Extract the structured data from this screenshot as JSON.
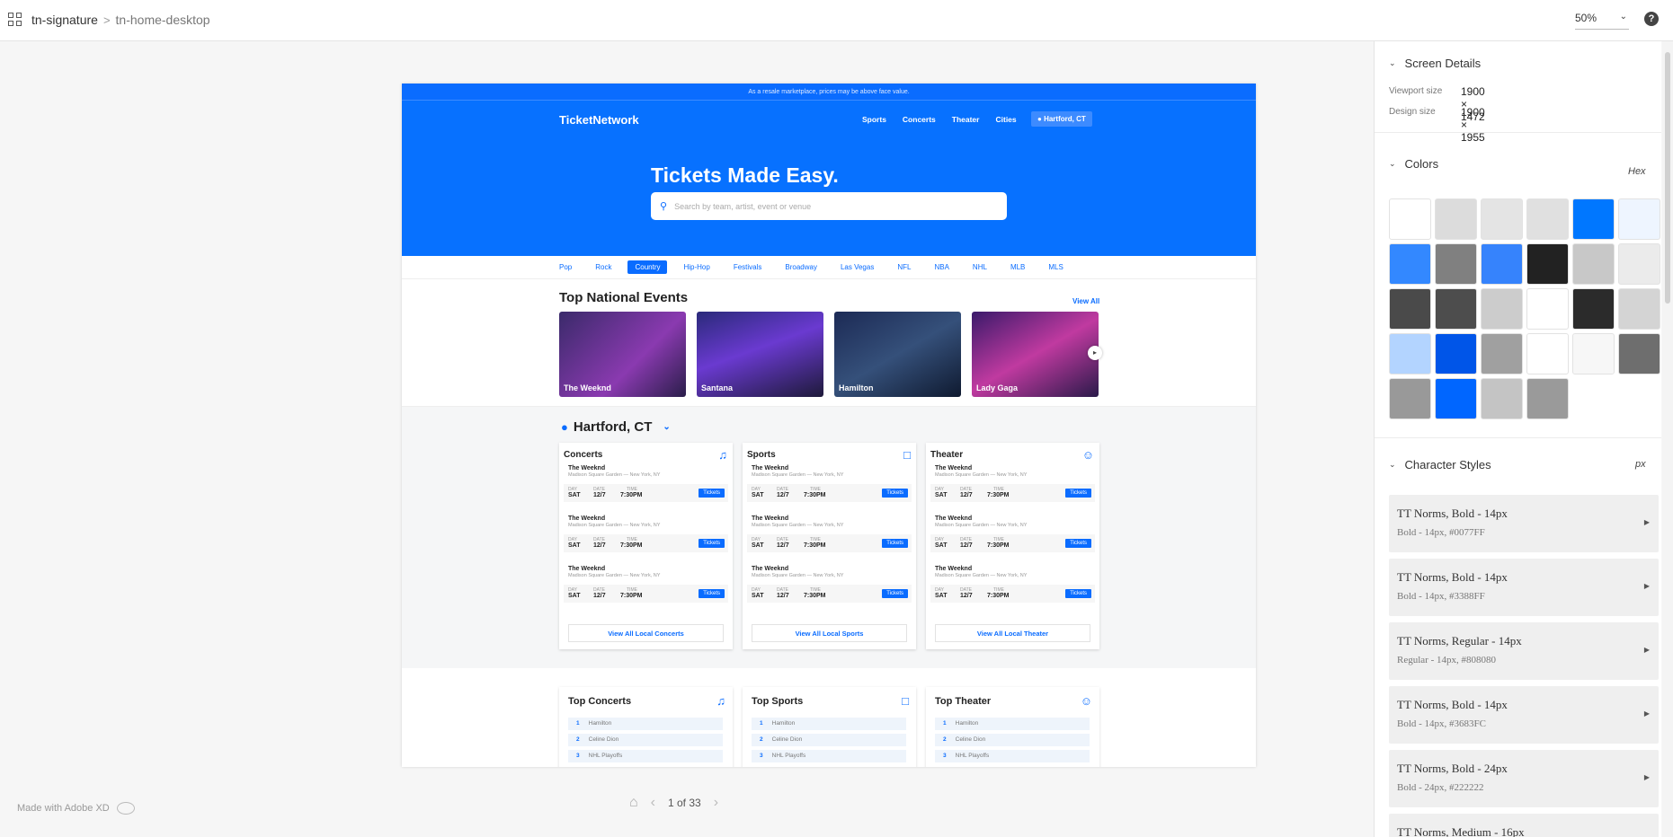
{
  "topbar": {
    "project": "tn-signature",
    "separator": ">",
    "page": "tn-home-desktop",
    "zoom": "50%",
    "help": "?"
  },
  "artboard": {
    "banner": "As a resale marketplace, prices may be above face value.",
    "logo": "TicketNetwork",
    "nav": [
      "Sports",
      "Concerts",
      "Theater",
      "Cities"
    ],
    "location_button": "Hartford, CT",
    "hero_title": "Tickets Made Easy.",
    "search_placeholder": "Search by team, artist, event or venue",
    "genres": [
      "Pop",
      "Rock",
      "Country",
      "Hip-Hop",
      "Festivals",
      "Broadway",
      "Las Vegas",
      "NFL",
      "NBA",
      "NHL",
      "MLB",
      "MLS"
    ],
    "active_genre": "Country",
    "top_national_title": "Top National Events",
    "view_all": "View All",
    "national_events": [
      "The Weeknd",
      "Santana",
      "Hamilton",
      "Lady Gaga"
    ],
    "city": "Hartford, CT",
    "panels": [
      {
        "title": "Concerts",
        "view_all": "View All Local Concerts",
        "icon": "music-icon"
      },
      {
        "title": "Sports",
        "view_all": "View All Local Sports",
        "icon": "jersey-icon"
      },
      {
        "title": "Theater",
        "view_all": "View All Local Theater",
        "icon": "masks-icon"
      }
    ],
    "event": {
      "name": "The Weeknd",
      "venue": "Madison Square Garden — New York, NY",
      "day_label": "DAY",
      "day": "SAT",
      "date_label": "DATE",
      "date": "12/7",
      "time_label": "TIME",
      "time": "7:30PM",
      "button": "Tickets"
    },
    "tops": [
      {
        "title": "Top Concerts"
      },
      {
        "title": "Top Sports"
      },
      {
        "title": "Top Theater"
      }
    ],
    "ranks": [
      {
        "n": "1",
        "name": "Hamilton"
      },
      {
        "n": "2",
        "name": "Celine Dion"
      },
      {
        "n": "3",
        "name": "NHL Playoffs"
      }
    ]
  },
  "footer": {
    "made_with": "Made with Adobe XD",
    "page_counter": "1 of 33"
  },
  "inspector": {
    "screen_details_title": "Screen Details",
    "viewport_label": "Viewport size",
    "viewport_value": "1900 × 1472",
    "design_label": "Design size",
    "design_value": "1900 × 1955",
    "colors_title": "Colors",
    "color_format": "Hex",
    "swatches": [
      "#ffffff",
      "#dcdcdc",
      "#e4e4e4",
      "#e0e0e0",
      "#0077ff",
      "#eef5ff",
      "#3388ff",
      "#808080",
      "#3683fc",
      "#222222",
      "#c8c8c8",
      "#ebebeb",
      "#4a4a4a",
      "#4d4d4d",
      "#cccccc",
      "#ffffff",
      "#2b2b2b",
      "#d4d4d4",
      "#b3d4ff",
      "#0055e8",
      "#a0a0a0",
      "#ffffff",
      "#f7f7f7",
      "#6e6e6e",
      "#999999",
      "#0066ff",
      "#c4c4c4",
      "#9a9a9a"
    ],
    "char_styles_title": "Character Styles",
    "char_unit": "px",
    "char_styles": [
      {
        "title": "TT Norms, Bold - 14px",
        "sub": "Bold - 14px, #0077FF"
      },
      {
        "title": "TT Norms, Bold - 14px",
        "sub": "Bold - 14px, #3388FF"
      },
      {
        "title": "TT Norms, Regular - 14px",
        "sub": "Regular - 14px, #808080"
      },
      {
        "title": "TT Norms, Bold - 14px",
        "sub": "Bold - 14px, #3683FC"
      },
      {
        "title": "TT Norms, Bold - 24px",
        "sub": "Bold - 24px, #222222"
      },
      {
        "title": "TT Norms, Medium - 16px",
        "sub": ""
      }
    ]
  }
}
